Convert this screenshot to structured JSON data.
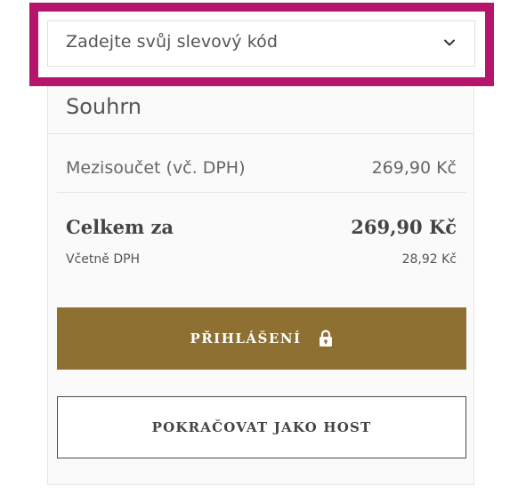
{
  "discount": {
    "label": "Zadejte svůj slevový kód",
    "icon": "chevron-down-icon"
  },
  "summary": {
    "title": "Souhrn",
    "subtotal_label": "Mezisoučet (vč. DPH)",
    "subtotal_value": "269,90 Kč",
    "total_label": "Celkem za",
    "total_value": "269,90 Kč",
    "vat_label": "Včetně DPH",
    "vat_value": "28,92 Kč"
  },
  "buttons": {
    "login_label": "PŘIHLÁŠENÍ",
    "login_icon": "lock-icon",
    "guest_label": "POKRAČOVAT JAKO HOST"
  },
  "colors": {
    "highlight": "#b5166b",
    "login_button": "#8f7033",
    "panel_background": "#fafafa"
  }
}
